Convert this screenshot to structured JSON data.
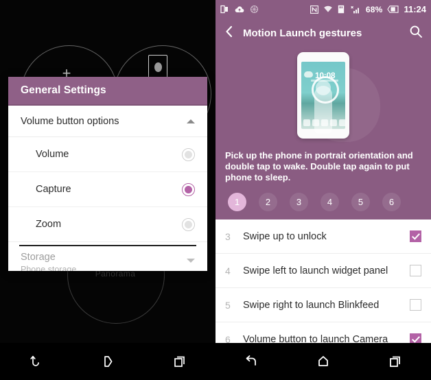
{
  "left_phone": {
    "camera_background": {
      "plus_icon": "plus-icon",
      "camera_icon": "camera-icon",
      "mode_label": "Panorama"
    },
    "dialog": {
      "title": "General Settings",
      "section": {
        "label": "Volume button options",
        "expanded_icon": "chevron-up-icon"
      },
      "options": [
        {
          "label": "Volume",
          "selected": false
        },
        {
          "label": "Capture",
          "selected": true
        },
        {
          "label": "Zoom",
          "selected": false
        }
      ],
      "storage": {
        "label": "Storage",
        "value": "Phone storage",
        "dropdown_icon": "chevron-down-icon"
      }
    },
    "navbar": {
      "back": "back-icon",
      "home": "home-icon",
      "recents": "recents-icon"
    }
  },
  "right_phone": {
    "statusbar": {
      "left_icons": [
        "sim-card-icon",
        "cloud-upload-icon",
        "sync-icon"
      ],
      "right_icons": [
        "nfc-icon",
        "wifi-icon",
        "sd-card-icon",
        "signal-icon"
      ],
      "battery_percent": "68%",
      "battery_icon": "battery-icon",
      "time": "11:24"
    },
    "appbar": {
      "back_icon": "back-chevron-icon",
      "title": "Motion Launch gestures",
      "search_icon": "search-icon"
    },
    "hero": {
      "device_illustration": "phone-illustration",
      "phone_clock": "10:08",
      "tap_indicator": "tap-ripple-icon"
    },
    "description": "Pick up the phone in portrait orientation and double tap to wake. Double tap again to put phone to sleep.",
    "pager": {
      "pages": [
        "1",
        "2",
        "3",
        "4",
        "5",
        "6"
      ],
      "active_index": 0
    },
    "gesture_list": [
      {
        "num": "3",
        "label": "Swipe up to unlock",
        "checked": true
      },
      {
        "num": "4",
        "label": "Swipe left to launch widget panel",
        "checked": false
      },
      {
        "num": "5",
        "label": "Swipe right to launch Blinkfeed",
        "checked": false
      },
      {
        "num": "6",
        "label": "Volume button to launch Camera",
        "checked": true
      }
    ],
    "navbar": {
      "back": "back-icon",
      "home": "home-icon",
      "recents": "recents-icon"
    }
  },
  "colors": {
    "purple_header": "#8a5c82",
    "dialog_header": "#8f6087",
    "accent": "#b362a6",
    "active_dot": "#e3b6da"
  }
}
